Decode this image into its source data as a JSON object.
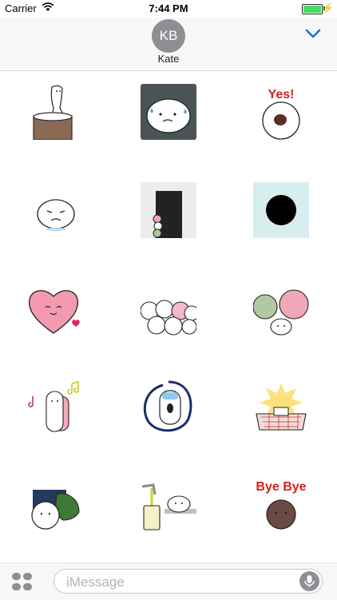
{
  "status_bar": {
    "carrier": "Carrier",
    "time": "7:44 PM",
    "icons": [
      "wifi-icon",
      "battery-icon",
      "charging-bolt-icon"
    ]
  },
  "header": {
    "avatar_initials": "KB",
    "contact_name": "Kate",
    "collapse_icon": "chevron-down-icon",
    "accent_color": "#1e74d6"
  },
  "stickers": [
    {
      "name": "mochi-pounding-mortar",
      "text": ""
    },
    {
      "name": "mochi-sweating-dark-square",
      "text": ""
    },
    {
      "name": "mochi-yes-bean",
      "text": "Yes!"
    },
    {
      "name": "mochi-crying",
      "text": ""
    },
    {
      "name": "mochi-peeking-door",
      "text": ""
    },
    {
      "name": "black-hole-square",
      "text": ""
    },
    {
      "name": "pink-heart-face",
      "text": ""
    },
    {
      "name": "mochi-crowd",
      "text": ""
    },
    {
      "name": "green-pink-mochi-trio",
      "text": ""
    },
    {
      "name": "mochi-music-notes",
      "text": ""
    },
    {
      "name": "mochi-scream-swirl",
      "text": ""
    },
    {
      "name": "mochi-grill-burst",
      "text": ""
    },
    {
      "name": "mochi-leaf-card",
      "text": ""
    },
    {
      "name": "mochi-tea-pour",
      "text": ""
    },
    {
      "name": "bye-bye-bean",
      "text": "Bye Bye"
    }
  ],
  "compose": {
    "apps_icon": "app-drawer-icon",
    "placeholder": "iMessage",
    "mic_icon": "microphone-icon"
  }
}
